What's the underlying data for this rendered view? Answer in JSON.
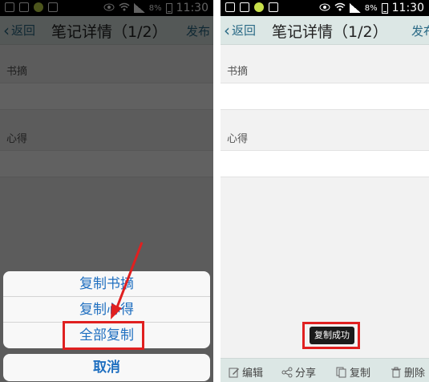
{
  "status_bar": {
    "battery": "8%",
    "time": "11:30"
  },
  "navbar": {
    "back_label": "返回",
    "title": "笔记详情（1/2）",
    "publish_label": "发布"
  },
  "sections": {
    "excerpt_label": "书摘",
    "thoughts_label": "心得"
  },
  "action_sheet": {
    "items": [
      "复制书摘",
      "复制心得",
      "全部复制"
    ],
    "cancel_label": "取消"
  },
  "toast": {
    "text": "复制成功"
  },
  "toolbar": {
    "edit": "编辑",
    "share": "分享",
    "copy": "复制",
    "delete": "删除"
  },
  "colors": {
    "accent": "#1f6fc0",
    "nav_bg": "#dce7e5",
    "highlight": "#e02020",
    "link": "#2a6a86"
  },
  "icons": [
    "eye-icon",
    "wifi-icon",
    "signal-icon",
    "battery-icon",
    "edit-icon",
    "share-icon",
    "copy-icon",
    "trash-icon"
  ]
}
